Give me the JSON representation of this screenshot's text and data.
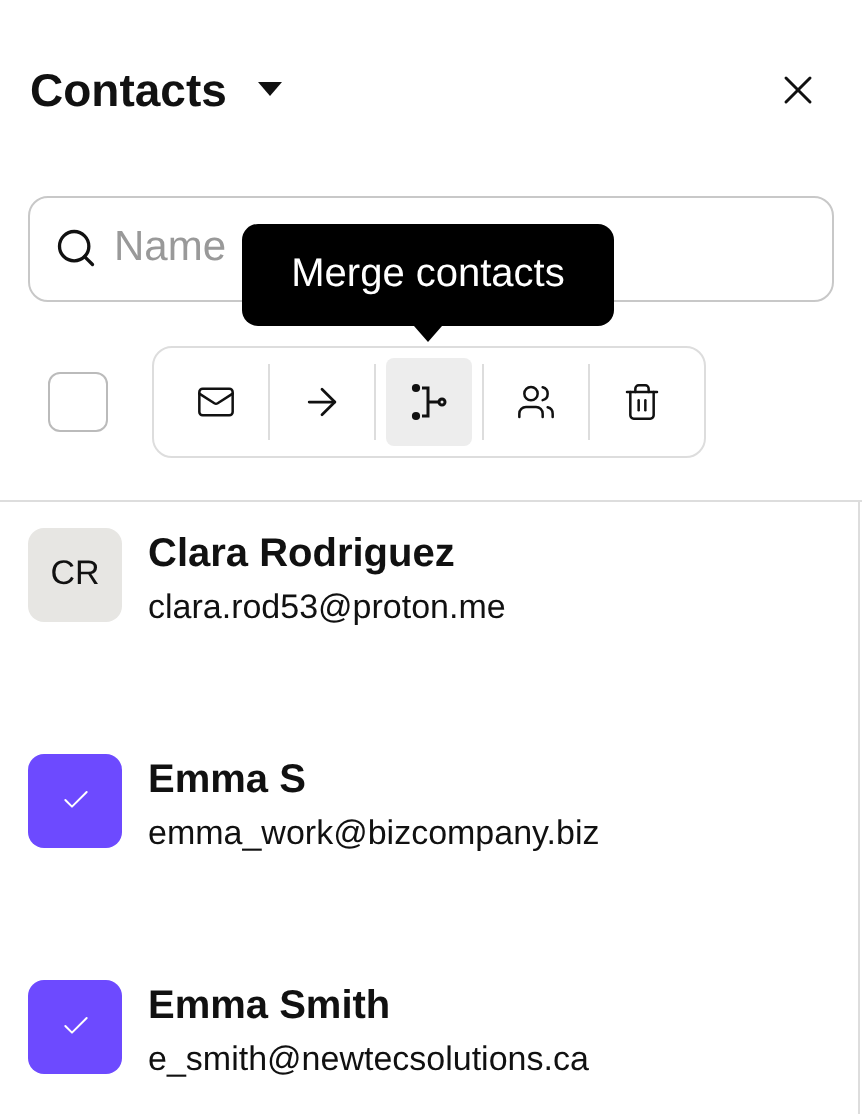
{
  "header": {
    "title": "Contacts"
  },
  "search": {
    "placeholder": "Name"
  },
  "select_all": {
    "checked": false
  },
  "toolbar": {
    "actions": [
      {
        "highlighted": false
      },
      {
        "highlighted": false
      },
      {
        "highlighted": true
      },
      {
        "highlighted": false
      },
      {
        "highlighted": false
      }
    ]
  },
  "tooltip": {
    "text": "Merge contacts"
  },
  "contacts": [
    {
      "name": "Clara Rodriguez",
      "email": "clara.rod53@proton.me",
      "initials": "CR",
      "selected": false
    },
    {
      "name": "Emma S",
      "email": "emma_work@bizcompany.biz",
      "selected": true
    },
    {
      "name": "Emma Smith",
      "email": "e_smith@newtecsolutions.ca",
      "selected": true
    }
  ]
}
